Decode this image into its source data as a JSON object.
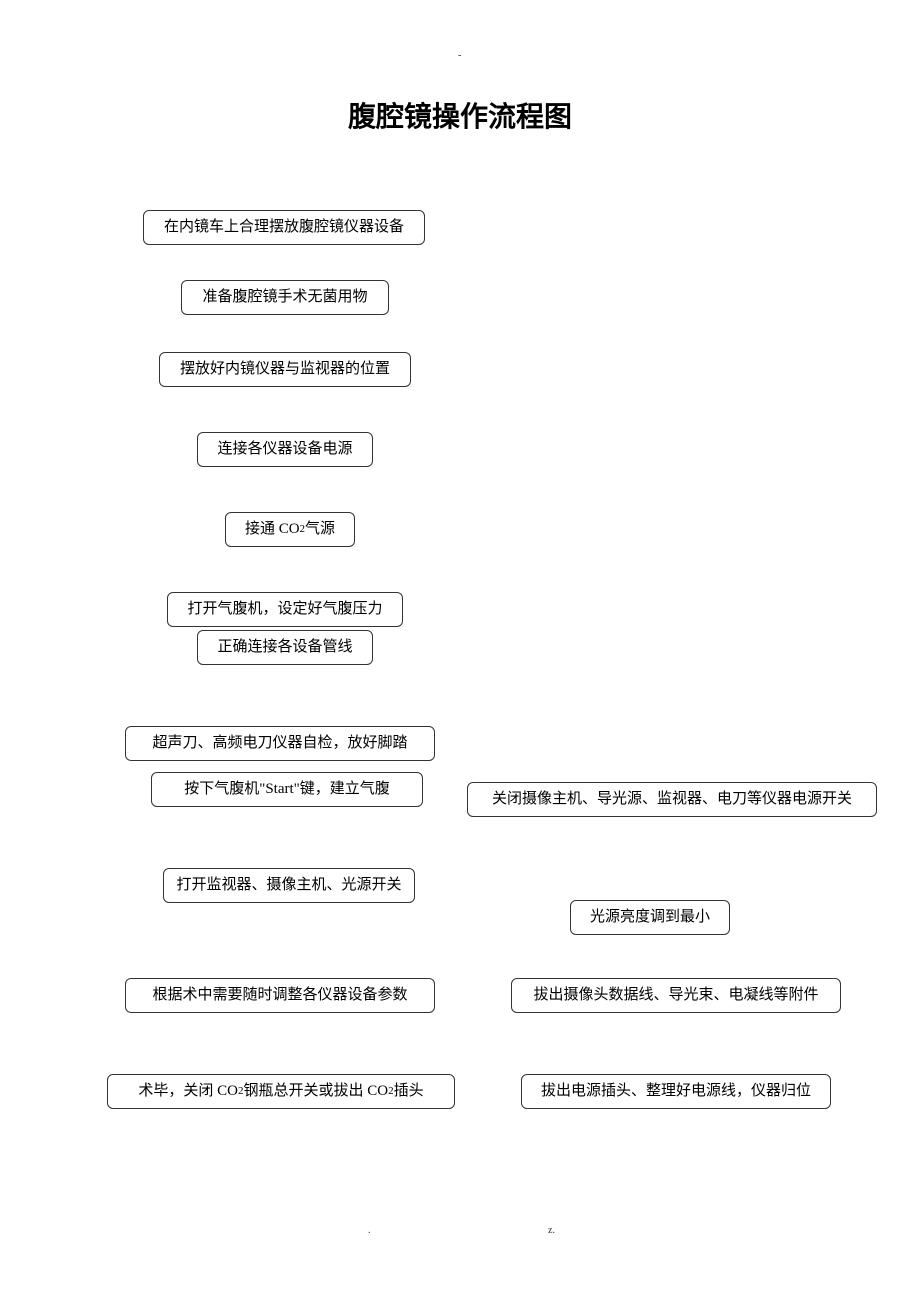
{
  "header_marker": "-",
  "title": "腹腔镜操作流程图",
  "boxes": {
    "b1": "在内镜车上合理摆放腹腔镜仪器设备",
    "b2": "准备腹腔镜手术无菌用物",
    "b3": "摆放好内镜仪器与监视器的位置",
    "b4": "连接各仪器设备电源",
    "b5_pre": "接通 CO",
    "b5_sub": "2",
    "b5_post": " 气源",
    "b6": "打开气腹机，设定好气腹压力",
    "b7": "正确连接各设备管线",
    "b8": "超声刀、高频电刀仪器自检，放好脚踏",
    "b9": "按下气腹机\"Start\"键，建立气腹",
    "b10": "打开监视器、摄像主机、光源开关",
    "b11": "根据术中需要随时调整各仪器设备参数",
    "b12_pre": "术毕，关闭 CO",
    "b12_sub": "2",
    "b12_mid": " 钢瓶总开关或拔出 CO",
    "b12_sub2": "2",
    "b12_post": " 插头",
    "r1": "关闭摄像主机、导光源、监视器、电刀等仪器电源开关",
    "r2": "光源亮度调到最小",
    "r3": "拔出摄像头数据线、导光束、电凝线等附件",
    "r4": "拔出电源插头、整理好电源线，仪器归位"
  },
  "footer_left": ".",
  "footer_right": "z."
}
